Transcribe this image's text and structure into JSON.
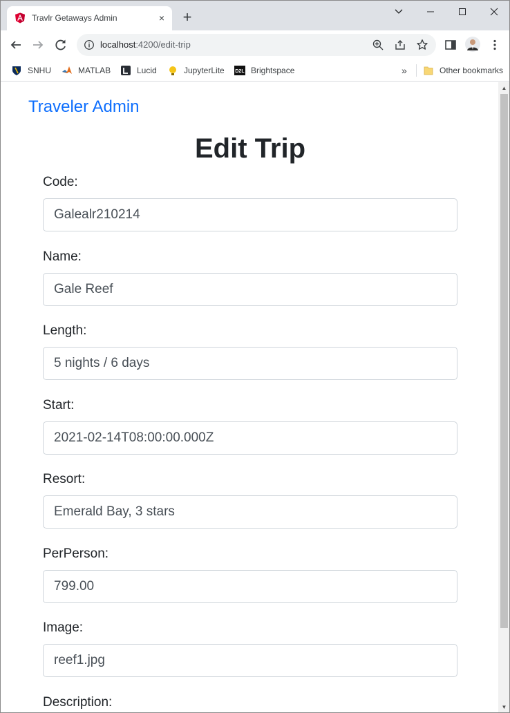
{
  "browser": {
    "tab_title": "Travlr Getaways Admin",
    "tab_favicon": "angular-icon",
    "tab_close": "×",
    "new_tab": "+",
    "url_host": "localhost",
    "url_path": ":4200/edit-trip",
    "bookmarks": [
      {
        "label": "SNHU",
        "icon": "snhu-shield-icon"
      },
      {
        "label": "MATLAB",
        "icon": "matlab-icon"
      },
      {
        "label": "Lucid",
        "icon": "lucid-icon"
      },
      {
        "label": "JupyterLite",
        "icon": "jupyterlite-icon"
      },
      {
        "label": "Brightspace",
        "icon": "d2l-icon"
      }
    ],
    "bookmarks_overflow": "»",
    "other_bookmarks": "Other bookmarks"
  },
  "page": {
    "brand": "Traveler Admin",
    "heading": "Edit Trip",
    "fields": [
      {
        "label": "Code:",
        "value": "Galealr210214"
      },
      {
        "label": "Name:",
        "value": "Gale Reef"
      },
      {
        "label": "Length:",
        "value": "5 nights / 6 days"
      },
      {
        "label": "Start:",
        "value": "2021-02-14T08:00:00.000Z"
      },
      {
        "label": "Resort:",
        "value": "Emerald Bay, 3 stars"
      },
      {
        "label": "PerPerson:",
        "value": "799.00"
      },
      {
        "label": "Image:",
        "value": "reef1.jpg"
      },
      {
        "label": "Description:",
        "value": ""
      }
    ]
  },
  "colors": {
    "brand_link": "#0d6efd",
    "tab_strip": "#dee1e6",
    "omnibox": "#f1f3f4"
  }
}
